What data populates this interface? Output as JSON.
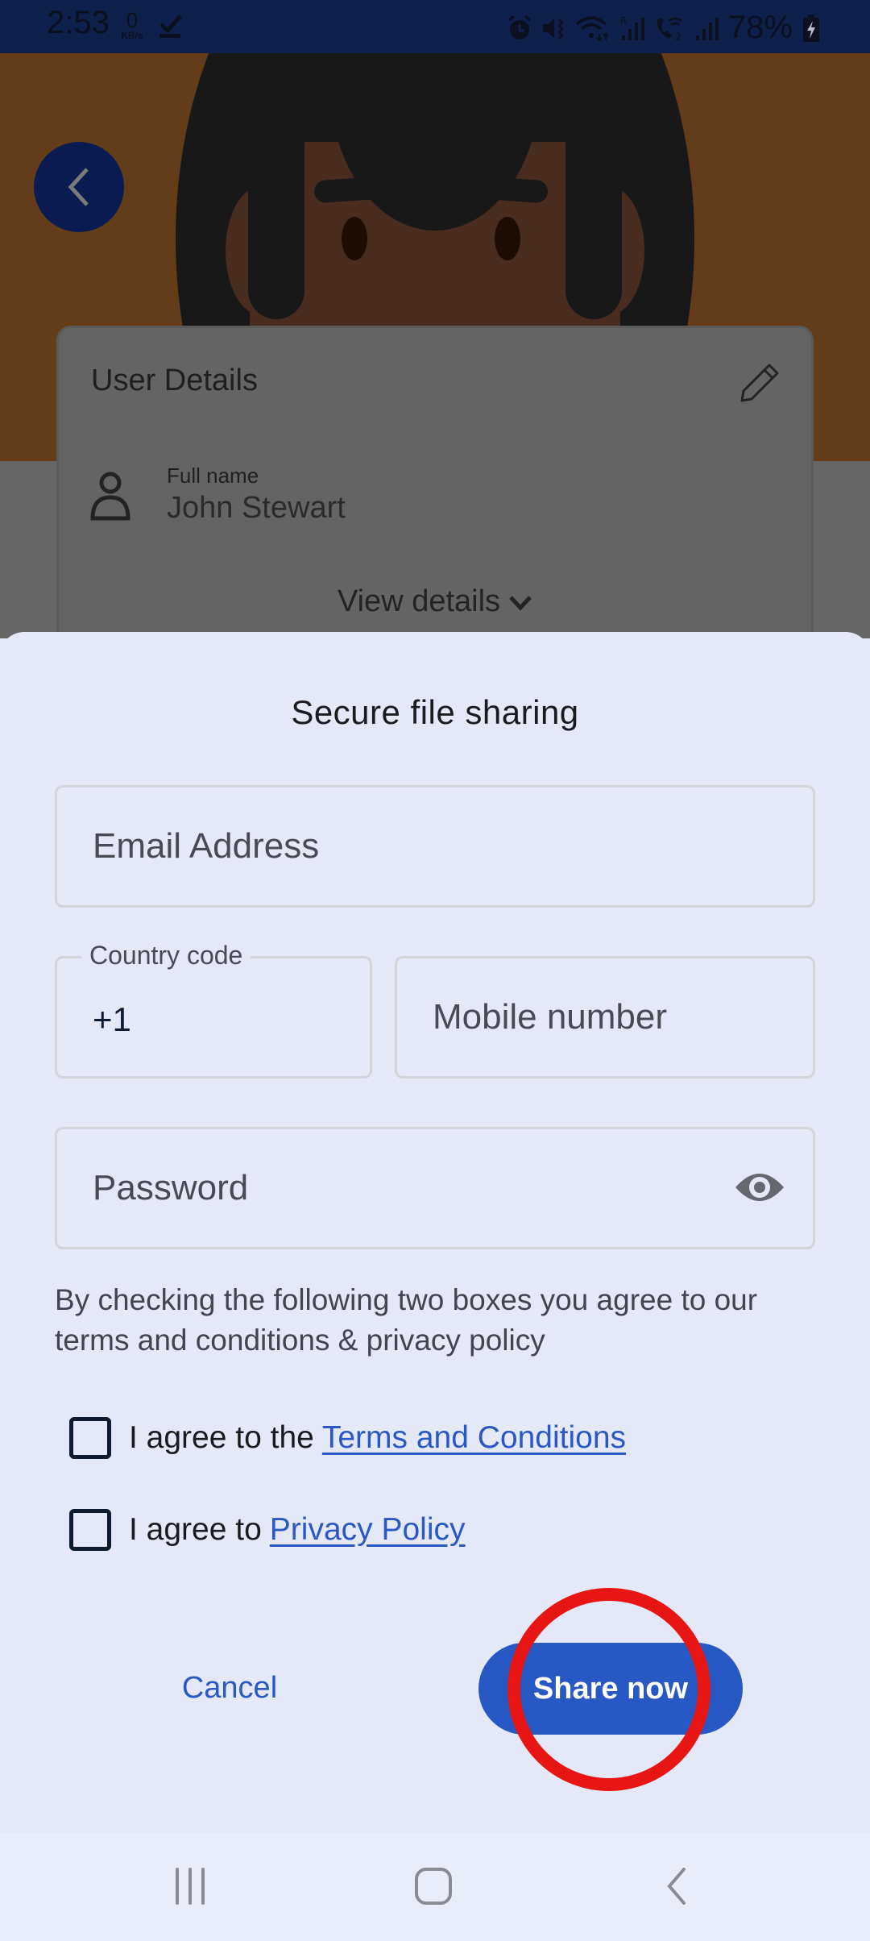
{
  "status_bar": {
    "time": "2:53",
    "net_speed_value": "0",
    "net_speed_unit": "KB/s",
    "battery_percent": "78%",
    "icons": [
      "download-done-icon",
      "alarm-icon",
      "mute-vibrate-icon",
      "wifi-icon",
      "signal-roaming-icon",
      "wifi-calling-icon",
      "signal-icon",
      "battery-charging-icon"
    ]
  },
  "background_page": {
    "back_button_icon": "chevron-left-icon",
    "card": {
      "title": "User Details",
      "edit_icon": "pencil-icon",
      "field_label": "Full name",
      "field_value": "John Stewart",
      "view_details_label": "View details"
    }
  },
  "sheet": {
    "title": "Secure file sharing",
    "email": {
      "placeholder": "Email Address",
      "value": ""
    },
    "country_code": {
      "label": "Country code",
      "value": "+1"
    },
    "mobile": {
      "placeholder": "Mobile number",
      "value": ""
    },
    "password": {
      "placeholder": "Password",
      "value": "",
      "toggle_icon": "eye-icon"
    },
    "consent_text": "By checking the following two boxes you agree to our terms and conditions & privacy policy",
    "checkboxes": [
      {
        "prefix": "I agree to the",
        "link": "Terms and Conditions",
        "checked": false
      },
      {
        "prefix": "I agree to",
        "link": "Privacy Policy",
        "checked": false
      }
    ],
    "cancel_label": "Cancel",
    "share_label": "Share now"
  },
  "colors": {
    "primary": "#2858c4",
    "link": "#2a59c6",
    "sheet_bg": "#e5e9f7",
    "annotation": "#e81515"
  },
  "nav_bar": {
    "buttons": [
      "recents-icon",
      "home-icon",
      "back-icon"
    ]
  }
}
